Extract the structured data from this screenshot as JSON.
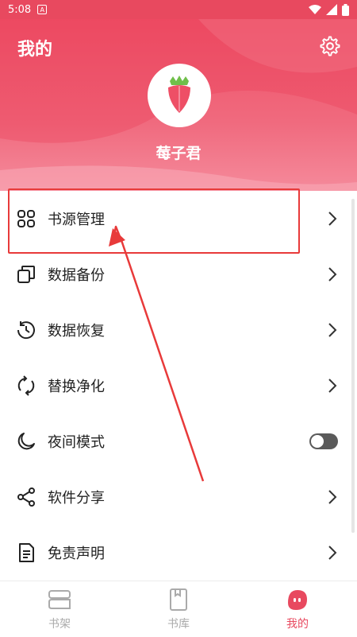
{
  "status_bar": {
    "time": "5:08",
    "notification_icon": "a-icon",
    "icons": [
      "wifi-icon",
      "signal-icon",
      "battery-icon"
    ]
  },
  "header": {
    "title": "我的",
    "settings_icon": "gear-icon",
    "avatar_icon": "strawberry-crown-icon",
    "username": "莓子君"
  },
  "menu": {
    "items": [
      {
        "label": "书源管理",
        "icon": "grid-icon"
      },
      {
        "label": "数据备份",
        "icon": "copy-icon"
      },
      {
        "label": "数据恢复",
        "icon": "restore-icon"
      },
      {
        "label": "替换净化",
        "icon": "refresh-icon"
      },
      {
        "label": "夜间模式",
        "icon": "moon-icon",
        "toggle": false
      },
      {
        "label": "软件分享",
        "icon": "share-icon"
      },
      {
        "label": "免责声明",
        "icon": "document-icon"
      }
    ]
  },
  "bottom_nav": {
    "items": [
      {
        "label": "书架",
        "icon": "bookshelf-icon",
        "active": false
      },
      {
        "label": "书库",
        "icon": "book-icon",
        "active": false
      },
      {
        "label": "我的",
        "icon": "profile-icon",
        "active": true
      }
    ]
  },
  "colors": {
    "accent": "#e8495f",
    "annotation": "#e83a3a",
    "text": "#222222",
    "inactive": "#aaaaaa"
  }
}
